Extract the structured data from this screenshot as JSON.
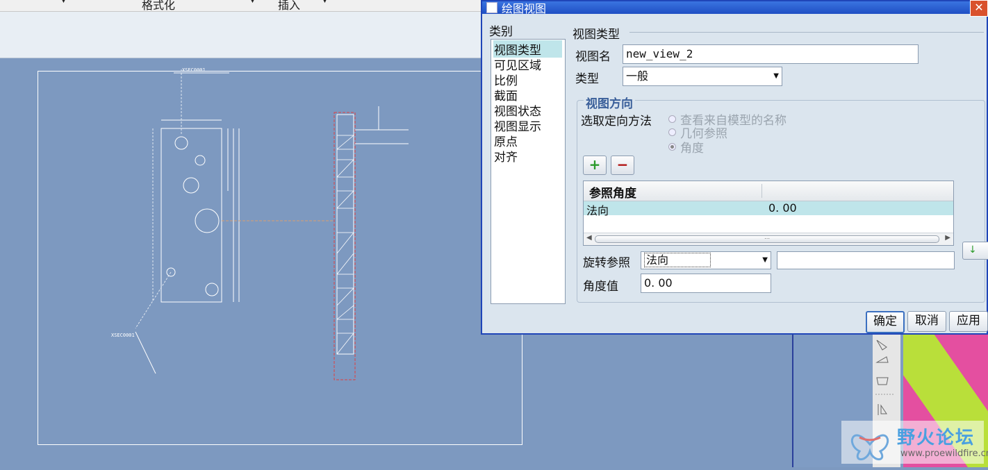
{
  "menubar": {
    "items": [
      "格式化",
      "插入"
    ]
  },
  "drawing": {
    "label_top": "XSEC0001",
    "label_left": "XSEC0001"
  },
  "dialog": {
    "title": "绘图视图",
    "close_glyph": "✕",
    "category_label": "类别",
    "categories": [
      {
        "label": "视图类型",
        "selected": true
      },
      {
        "label": "可见区域",
        "selected": false
      },
      {
        "label": "比例",
        "selected": false
      },
      {
        "label": "截面",
        "selected": false
      },
      {
        "label": "视图状态",
        "selected": false
      },
      {
        "label": "视图显示",
        "selected": false
      },
      {
        "label": "原点",
        "selected": false
      },
      {
        "label": "对齐",
        "selected": false
      }
    ],
    "section_title": "视图类型",
    "view_name_label": "视图名",
    "view_name_value": "new_view_2",
    "type_label": "类型",
    "type_value": "一般",
    "orientation_title": "视图方向",
    "orientation_method_label": "选取定向方法",
    "orientation_options": [
      {
        "label": "查看来自模型的名称",
        "checked": false
      },
      {
        "label": "几何参照",
        "checked": false
      },
      {
        "label": "角度",
        "checked": true
      }
    ],
    "add_glyph": "+",
    "remove_glyph": "−",
    "table": {
      "headers": [
        "参照角度",
        ""
      ],
      "rows": [
        {
          "ref": "法向",
          "angle": "0. 00"
        }
      ],
      "scroll_grip": "⋯"
    },
    "rotate_ref_label": "旋转参照",
    "rotate_ref_value": "法向",
    "angle_value_label": "角度值",
    "angle_value": "0. 00",
    "buttons": {
      "ok": "确定",
      "cancel": "取消",
      "apply": "应用"
    }
  },
  "watermark": {
    "name": "野火论坛",
    "url": "www.proewildfire.cn"
  }
}
